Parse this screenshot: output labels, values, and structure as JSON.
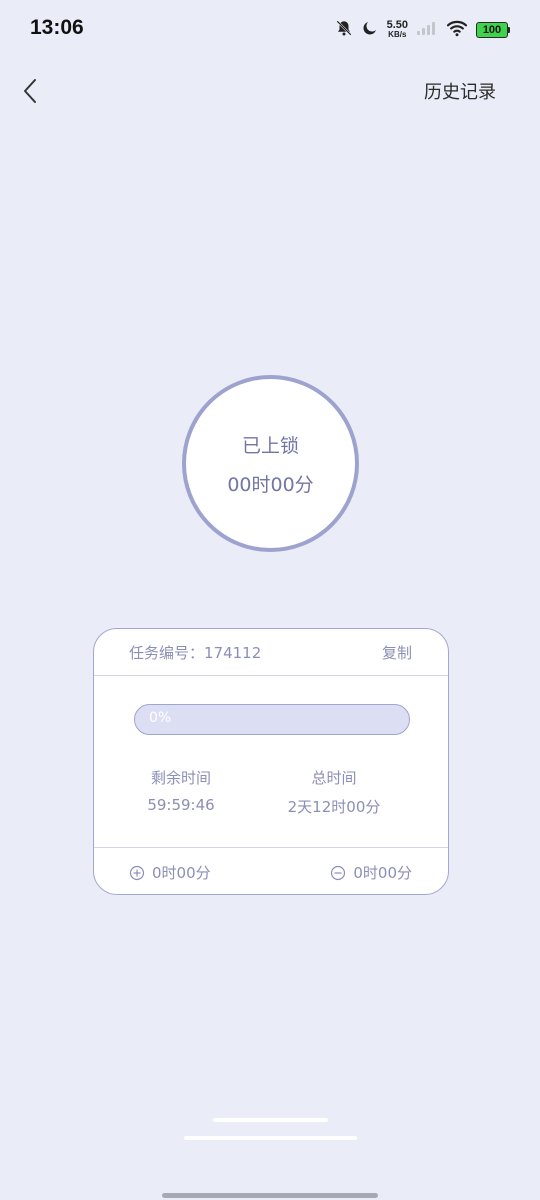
{
  "status_bar": {
    "time": "13:06",
    "net_speed_value": "5.50",
    "net_speed_unit": "KB/s",
    "battery": "100",
    "icons": [
      "bell-off-icon",
      "moon-icon",
      "signal-icon",
      "wifi-icon",
      "battery-icon"
    ]
  },
  "header": {
    "back_icon": "chevron-left-icon",
    "history_label": "历史记录"
  },
  "lock": {
    "status": "已上锁",
    "duration": "00时00分"
  },
  "task": {
    "id_label": "任务编号：174112",
    "copy_label": "复制",
    "progress": 0,
    "progress_text": "0%",
    "remaining_label": "剩余时间",
    "remaining_value": "59:59:46",
    "total_label": "总时间",
    "total_value": "2天12时00分",
    "add_value": "0时00分",
    "subtract_value": "0时00分"
  },
  "colors": {
    "background": "#eaedf7",
    "accent": "#9ea2cf",
    "text_muted": "#8b8fb6",
    "progress_bg": "#dcdff4",
    "battery": "#3dd34b"
  }
}
